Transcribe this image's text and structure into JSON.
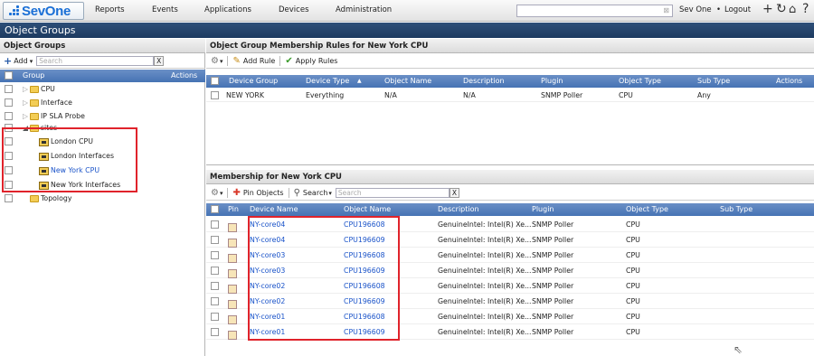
{
  "logo": {
    "text": "SevOne"
  },
  "nav": [
    "Reports",
    "Events",
    "Applications",
    "Devices",
    "Administration"
  ],
  "user": {
    "name": "Sev One",
    "separator": "•",
    "logout": "Logout"
  },
  "page_title": "Object Groups",
  "left": {
    "header": "Object Groups",
    "add_label": "Add",
    "search_placeholder": "Search",
    "clear_label": "X",
    "col_group": "Group",
    "col_actions": "Actions",
    "tree": [
      "CPU",
      "Interface",
      "IP SLA Probe",
      "sites",
      "London CPU",
      "London Interfaces",
      "New York CPU",
      "New York Interfaces",
      "Topology"
    ]
  },
  "rules": {
    "header": "Object Group Membership Rules for New York CPU",
    "add_rule": "Add Rule",
    "apply_rules": "Apply Rules",
    "columns": [
      "Device Group",
      "Device Type",
      "Object Name",
      "Description",
      "Plugin",
      "Object Type",
      "Sub Type",
      "Actions"
    ],
    "sort_arrow": "▲",
    "rows": [
      [
        "NEW YORK",
        "Everything",
        "N/A",
        "N/A",
        "SNMP Poller",
        "CPU",
        "Any"
      ]
    ]
  },
  "membership": {
    "header": "Membership for New York CPU",
    "pin_objects": "Pin Objects",
    "search_label": "Search",
    "search_placeholder": "Search",
    "clear_label": "X",
    "columns": [
      "Pin",
      "Device Name",
      "Object Name",
      "Description",
      "Plugin",
      "Object Type",
      "Sub Type"
    ],
    "rows": [
      [
        "NY-core04",
        "CPU196608",
        "GenuineIntel: Intel(R) Xe...",
        "SNMP Poller",
        "CPU"
      ],
      [
        "NY-core04",
        "CPU196609",
        "GenuineIntel: Intel(R) Xe...",
        "SNMP Poller",
        "CPU"
      ],
      [
        "NY-core03",
        "CPU196608",
        "GenuineIntel: Intel(R) Xe...",
        "SNMP Poller",
        "CPU"
      ],
      [
        "NY-core03",
        "CPU196609",
        "GenuineIntel: Intel(R) Xe...",
        "SNMP Poller",
        "CPU"
      ],
      [
        "NY-core02",
        "CPU196608",
        "GenuineIntel: Intel(R) Xe...",
        "SNMP Poller",
        "CPU"
      ],
      [
        "NY-core02",
        "CPU196609",
        "GenuineIntel: Intel(R) Xe...",
        "SNMP Poller",
        "CPU"
      ],
      [
        "NY-core01",
        "CPU196608",
        "GenuineIntel: Intel(R) Xe...",
        "SNMP Poller",
        "CPU"
      ],
      [
        "NY-core01",
        "CPU196609",
        "GenuineIntel: Intel(R) Xe...",
        "SNMP Poller",
        "CPU"
      ]
    ]
  },
  "colors": {
    "title_bar": "#1c3a60",
    "column_header": "#4673b4",
    "link": "#1a53c9",
    "highlight": "#e0232b"
  }
}
